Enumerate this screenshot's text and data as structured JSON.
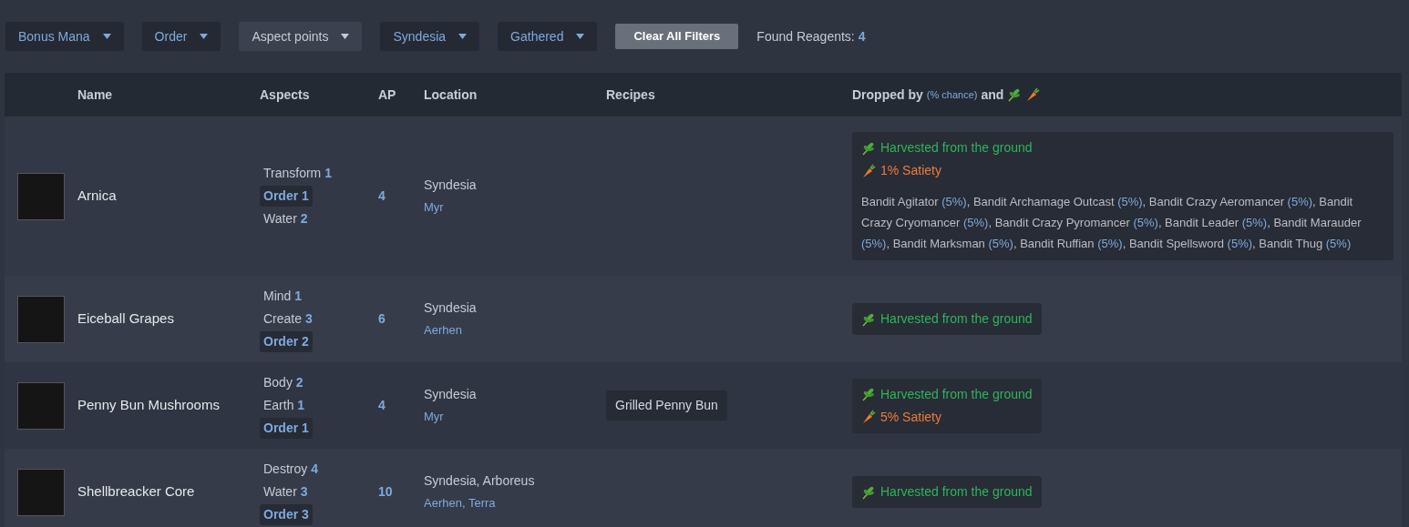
{
  "filters": [
    {
      "label": "Bonus Mana",
      "kind": "set"
    },
    {
      "label": "Order",
      "kind": "set"
    },
    {
      "label": "Aspect points",
      "kind": "unset"
    },
    {
      "label": "Syndesia",
      "kind": "set"
    },
    {
      "label": "Gathered",
      "kind": "set"
    }
  ],
  "clear_button": "Clear All Filters",
  "found": {
    "label": "Found Reagents:",
    "count": "4"
  },
  "table": {
    "columns": [
      "Name",
      "Aspects",
      "AP",
      "Location",
      "Recipes"
    ],
    "dropped_header": {
      "label": "Dropped by",
      "hint": "(% chance)",
      "conjunction": "and"
    },
    "rows": [
      {
        "name": "Arnica",
        "aspects": [
          {
            "name": "Transform",
            "value": "1",
            "highlighted": false
          },
          {
            "name": "Order",
            "value": "1",
            "highlighted": true
          },
          {
            "name": "Water",
            "value": "2",
            "highlighted": false
          }
        ],
        "ap": "4",
        "region": "Syndesia",
        "place": "Myr",
        "recipes": [],
        "harvest": "Harvested from the ground",
        "satiety": "1% Satiety",
        "drops": [
          {
            "name": "Bandit Agitator",
            "chance": "(5%)",
            "separator": ","
          },
          {
            "name": "Bandit Archamage Outcast",
            "chance": "(5%)",
            "separator": ","
          },
          {
            "name": "Bandit Crazy Aeromancer",
            "chance": "(5%)",
            "separator": ","
          },
          {
            "name": "Bandit Crazy Cryomancer",
            "chance": "(5%)",
            "separator": ","
          },
          {
            "name": "Bandit Crazy Pyromancer",
            "chance": "(5%)",
            "separator": ","
          },
          {
            "name": "Bandit Leader",
            "chance": "(5%)",
            "separator": ","
          },
          {
            "name": "Bandit Marauder",
            "chance": "(5%)",
            "separator": ","
          },
          {
            "name": "Bandit Marksman",
            "chance": "(5%)",
            "separator": ","
          },
          {
            "name": "Bandit Ruffian",
            "chance": "(5%)",
            "separator": ","
          },
          {
            "name": "Bandit Spellsword",
            "chance": "(5%)",
            "separator": ","
          },
          {
            "name": "Bandit Thug",
            "chance": "(5%)"
          }
        ]
      },
      {
        "name": "Eiceball Grapes",
        "aspects": [
          {
            "name": "Mind",
            "value": "1",
            "highlighted": false
          },
          {
            "name": "Create",
            "value": "3",
            "highlighted": false
          },
          {
            "name": "Order",
            "value": "2",
            "highlighted": true
          }
        ],
        "ap": "6",
        "region": "Syndesia",
        "place": "Aerhen",
        "recipes": [],
        "harvest": "Harvested from the ground",
        "drops": []
      },
      {
        "name": "Penny Bun Mushrooms",
        "aspects": [
          {
            "name": "Body",
            "value": "2",
            "highlighted": false
          },
          {
            "name": "Earth",
            "value": "1",
            "highlighted": false
          },
          {
            "name": "Order",
            "value": "1",
            "highlighted": true
          }
        ],
        "ap": "4",
        "region": "Syndesia",
        "place": "Myr",
        "recipes": [
          "Grilled Penny Bun"
        ],
        "harvest": "Harvested from the ground",
        "satiety": "5% Satiety",
        "drops": []
      },
      {
        "name": "Shellbreacker Core",
        "aspects": [
          {
            "name": "Destroy",
            "value": "4",
            "highlighted": false
          },
          {
            "name": "Water",
            "value": "3",
            "highlighted": false
          },
          {
            "name": "Order",
            "value": "3",
            "highlighted": true
          }
        ],
        "ap": "10",
        "region": "Syndesia, Arboreus",
        "place": "Aerhen, Terra",
        "recipes": [],
        "harvest": "Harvested from the ground",
        "drops": []
      }
    ]
  }
}
